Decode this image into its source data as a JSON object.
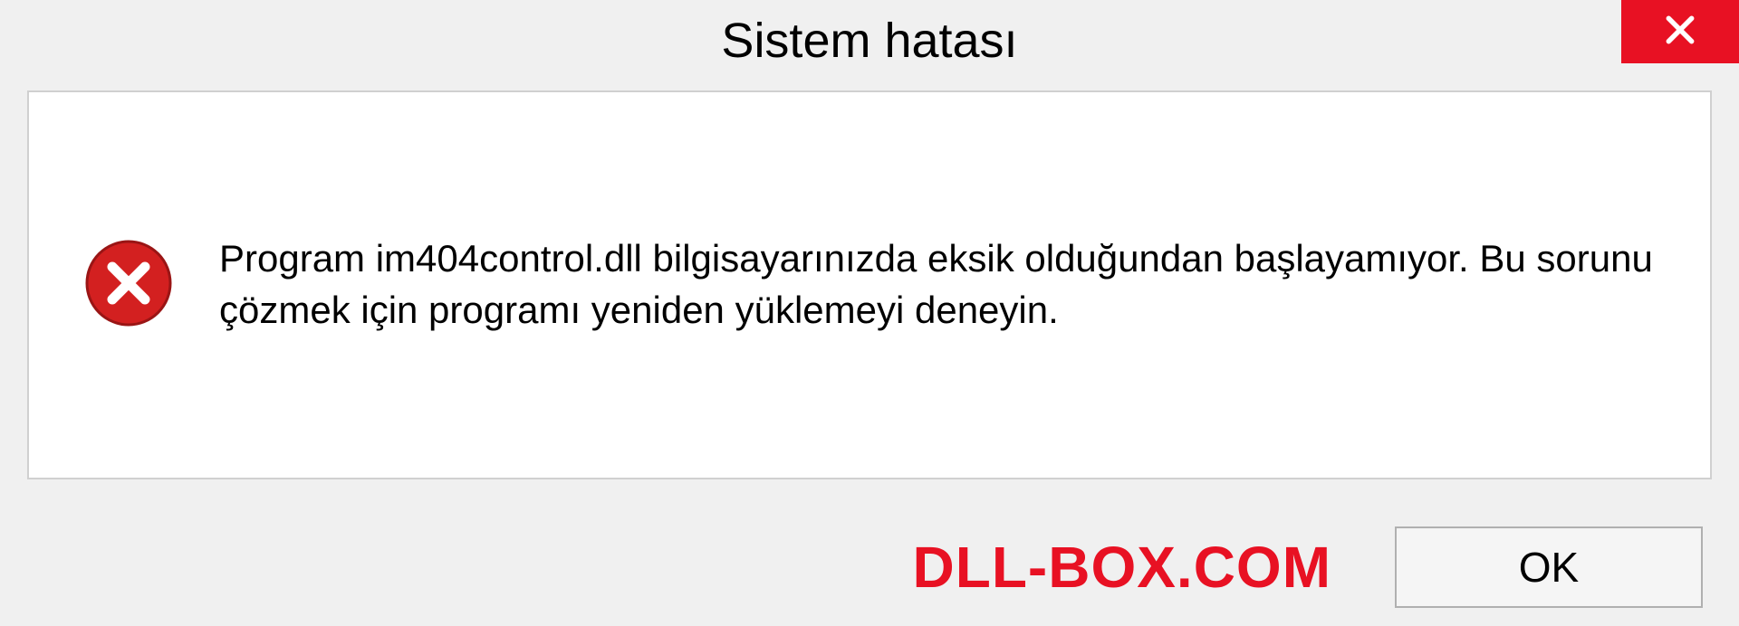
{
  "dialog": {
    "title": "Sistem hatası",
    "message": "Program im404control.dll bilgisayarınızda eksik olduğundan başlayamıyor. Bu sorunu çözmek için programı yeniden yüklemeyi deneyin.",
    "ok_label": "OK"
  },
  "watermark": {
    "text": "DLL-BOX.COM"
  },
  "icons": {
    "close": "close-icon",
    "error": "error-icon"
  },
  "colors": {
    "close_bg": "#e81123",
    "error_icon": "#d32020",
    "watermark": "#e81123"
  }
}
